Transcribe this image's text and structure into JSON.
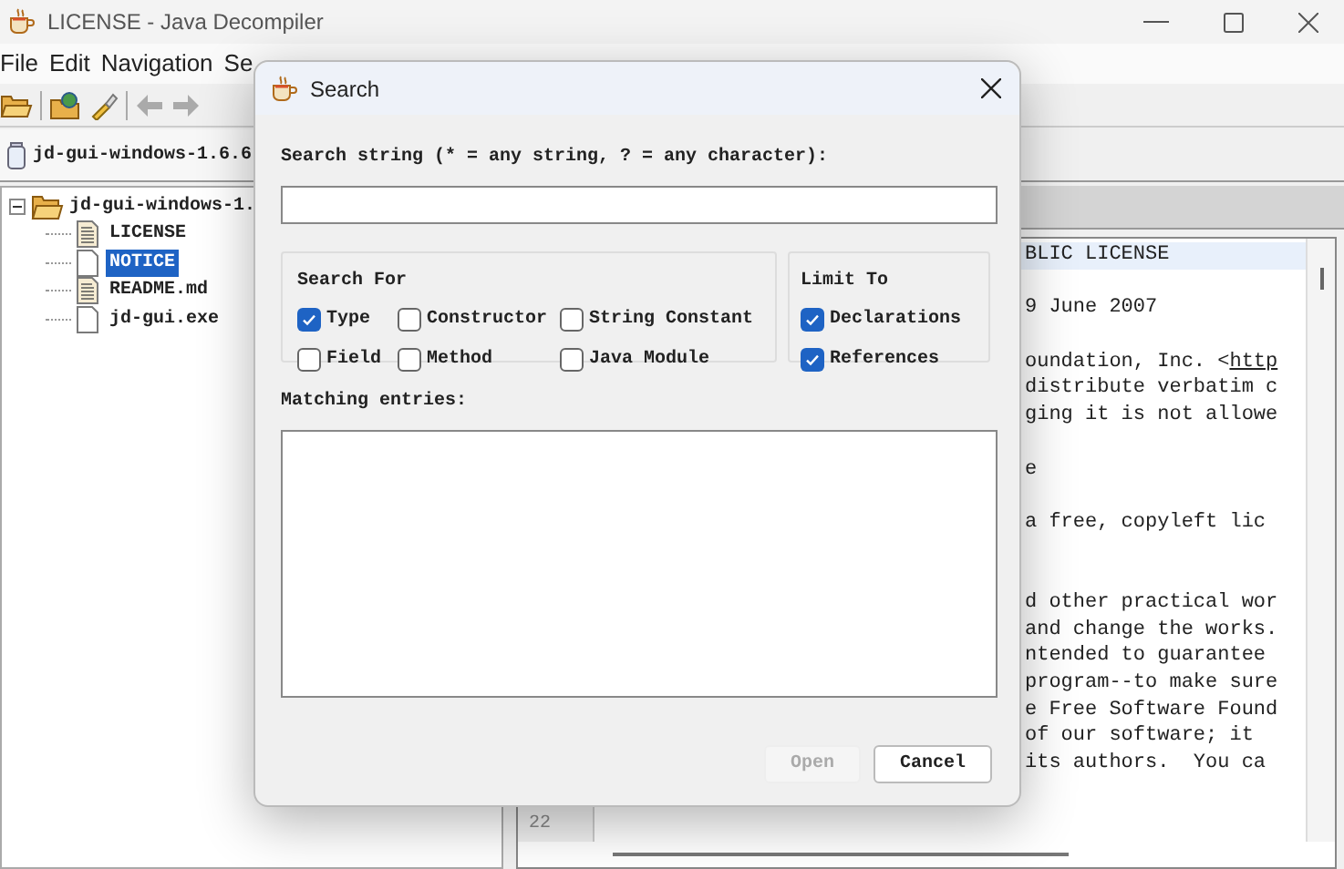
{
  "window": {
    "title": "LICENSE - Java Decompiler"
  },
  "menu": [
    "File",
    "Edit",
    "Navigation",
    "Se"
  ],
  "tabs": [
    {
      "label": "jd-gui-windows-1.6.6",
      "selected": true
    }
  ],
  "tree": {
    "label": "jd-gui-windows-1.",
    "expanded": true,
    "children": [
      {
        "label": "LICENSE",
        "kind": "text",
        "selected": false
      },
      {
        "label": "NOTICE",
        "kind": "blank",
        "selected": true
      },
      {
        "label": "README.md",
        "kind": "text",
        "selected": false
      },
      {
        "label": "jd-gui.exe",
        "kind": "blank",
        "selected": false
      }
    ]
  },
  "code": {
    "line_number": "22",
    "lines": [
      {
        "kind": "text",
        "text": "BLIC LICENSE",
        "highlighted": true
      },
      {
        "kind": "blank"
      },
      {
        "kind": "text",
        "text": "9 June 2007",
        "highlighted": false
      },
      {
        "kind": "blank"
      },
      {
        "kind": "text",
        "text": "oundation, Inc. <",
        "link": "http",
        "highlighted": false
      },
      {
        "kind": "text",
        "text": "distribute verbatim c",
        "highlighted": false
      },
      {
        "kind": "text",
        "text": "ging it is not allowe",
        "highlighted": false
      },
      {
        "kind": "blank"
      },
      {
        "kind": "text",
        "text": "e",
        "highlighted": false
      },
      {
        "kind": "blank"
      },
      {
        "kind": "text",
        "text": "a free, copyleft lic",
        "highlighted": false
      },
      {
        "kind": "blank"
      },
      {
        "kind": "blank"
      },
      {
        "kind": "text",
        "text": "d other practical wor",
        "highlighted": false
      },
      {
        "kind": "text",
        "text": "and change the works.",
        "highlighted": false
      },
      {
        "kind": "text",
        "text": "ntended to guarantee",
        "highlighted": false
      },
      {
        "kind": "text",
        "text": "program--to make sure",
        "highlighted": false
      },
      {
        "kind": "text",
        "text": "e Free Software Found",
        "highlighted": false
      },
      {
        "kind": "text",
        "text": "of our software; it",
        "highlighted": false
      },
      {
        "kind": "text",
        "text": "its authors.  You ca",
        "highlighted": false
      }
    ]
  },
  "dialog": {
    "title": "Search",
    "search_label": "Search string (* = any string, ? = any character):",
    "search_for": {
      "title": "Search For",
      "options": [
        {
          "label": "Type",
          "checked": true
        },
        {
          "label": "Constructor",
          "checked": false
        },
        {
          "label": "String Constant",
          "checked": false
        },
        {
          "label": "Field",
          "checked": false
        },
        {
          "label": "Method",
          "checked": false
        },
        {
          "label": "Java Module",
          "checked": false
        }
      ]
    },
    "limit_to": {
      "title": "Limit To",
      "options": [
        {
          "label": "Declarations",
          "checked": true
        },
        {
          "label": "References",
          "checked": true
        }
      ]
    },
    "matching_label": "Matching entries:",
    "buttons": [
      {
        "label": "Open",
        "disabled": true
      },
      {
        "label": "Cancel",
        "disabled": false
      }
    ]
  }
}
